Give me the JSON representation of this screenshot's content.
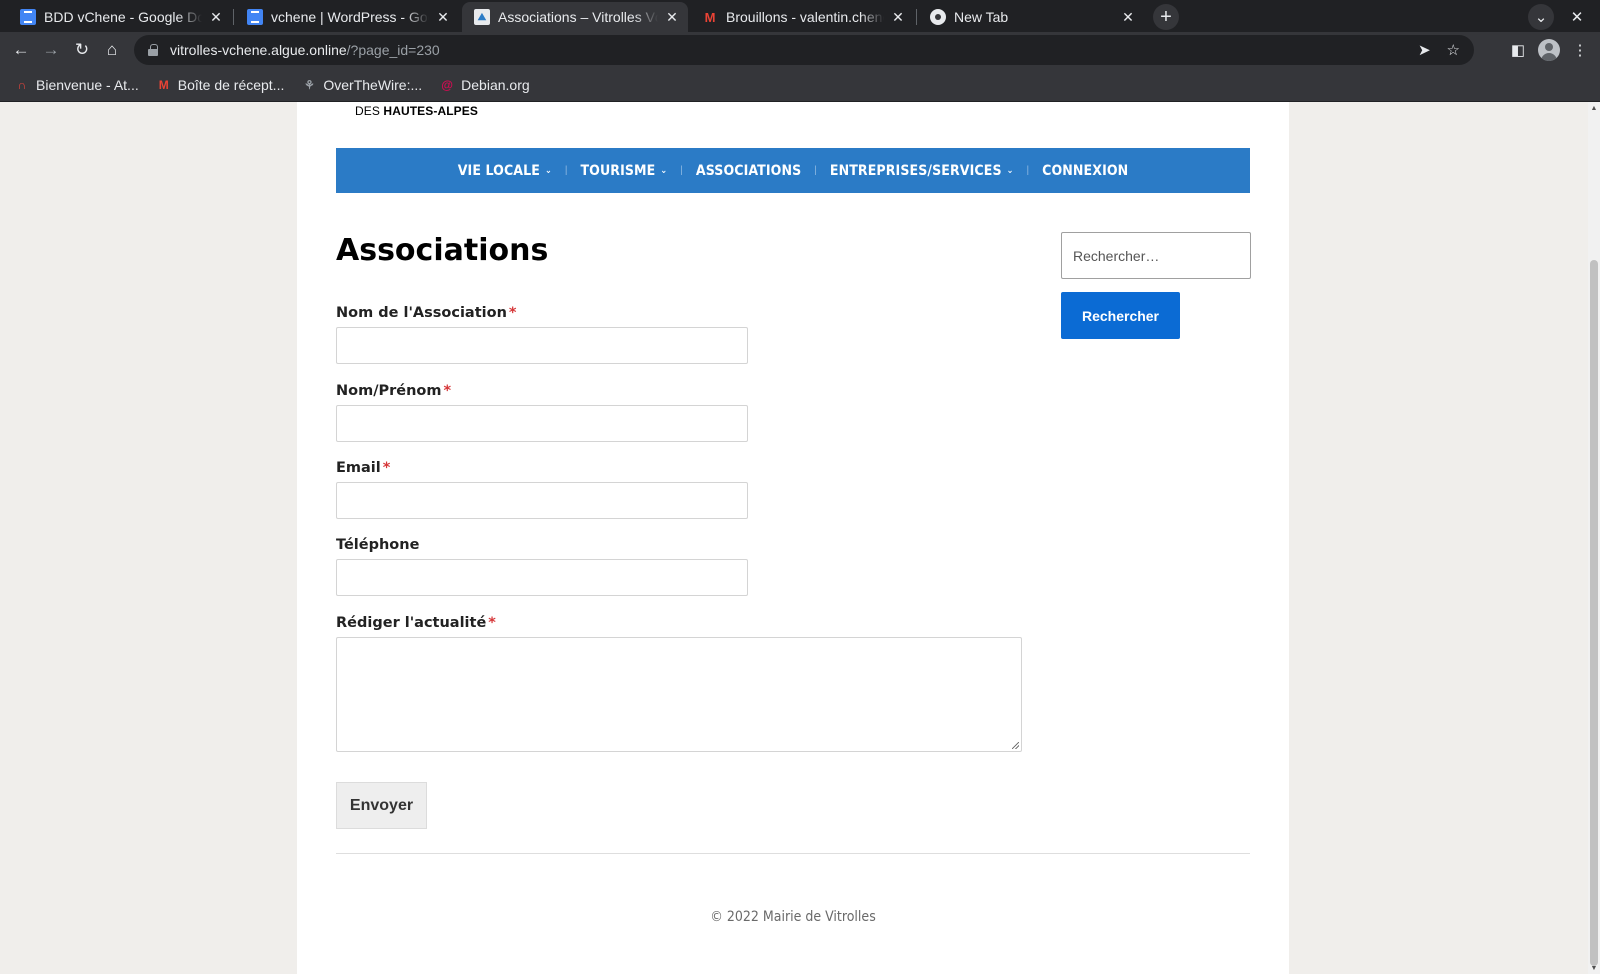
{
  "browser": {
    "tabs": [
      {
        "title": "BDD vChene - Google Docs",
        "icon": "docs-icon"
      },
      {
        "title": "vchene | WordPress - Google Docs",
        "icon": "docs-icon"
      },
      {
        "title": "Associations – Vitrolles Vchene",
        "icon": "site-icon",
        "active": true
      },
      {
        "title": "Brouillons - valentin.chene",
        "icon": "gmail-icon"
      },
      {
        "title": "New Tab",
        "icon": "chrome-icon"
      }
    ],
    "close_glyph": "✕",
    "new_tab_glyph": "+",
    "url_host": "vitrolles-vchene.algue.online",
    "url_path": "/?page_id=230",
    "bookmarks": [
      {
        "label": "Bienvenue - At...",
        "icon": "app-icon",
        "color": "#e8453c"
      },
      {
        "label": "Boîte de récept...",
        "icon": "gmail-icon",
        "color": "#ea4335"
      },
      {
        "label": "OverTheWire:...",
        "icon": "otw-icon",
        "color": "#9aa0a6"
      },
      {
        "label": "Debian.org",
        "icon": "debian-icon",
        "color": "#d70a53"
      }
    ]
  },
  "site": {
    "tagline_prefix": "DES",
    "tagline_strong": "HAUTES-ALPES",
    "nav": [
      {
        "label": "VIE LOCALE",
        "has_dropdown": true
      },
      {
        "label": "TOURISME",
        "has_dropdown": true
      },
      {
        "label": "ASSOCIATIONS",
        "has_dropdown": false
      },
      {
        "label": "ENTREPRISES/SERVICES",
        "has_dropdown": true
      },
      {
        "label": "CONNEXION",
        "has_dropdown": false
      }
    ],
    "nav_color": "#2b7bc6",
    "page_title": "Associations",
    "form": {
      "required_mark": "*",
      "fields": [
        {
          "label": "Nom de l'Association",
          "required": true,
          "value": ""
        },
        {
          "label": "Nom/Prénom",
          "required": true,
          "value": ""
        },
        {
          "label": "Email",
          "required": true,
          "value": ""
        },
        {
          "label": "Téléphone",
          "required": false,
          "value": ""
        },
        {
          "label": "Rédiger l'actualité",
          "required": true,
          "value": ""
        }
      ],
      "submit_label": "Envoyer"
    },
    "search": {
      "placeholder": "Rechercher…",
      "button_label": "Rechercher",
      "button_color": "#0b6bd4"
    },
    "footer": "© 2022 Mairie de Vitrolles"
  }
}
